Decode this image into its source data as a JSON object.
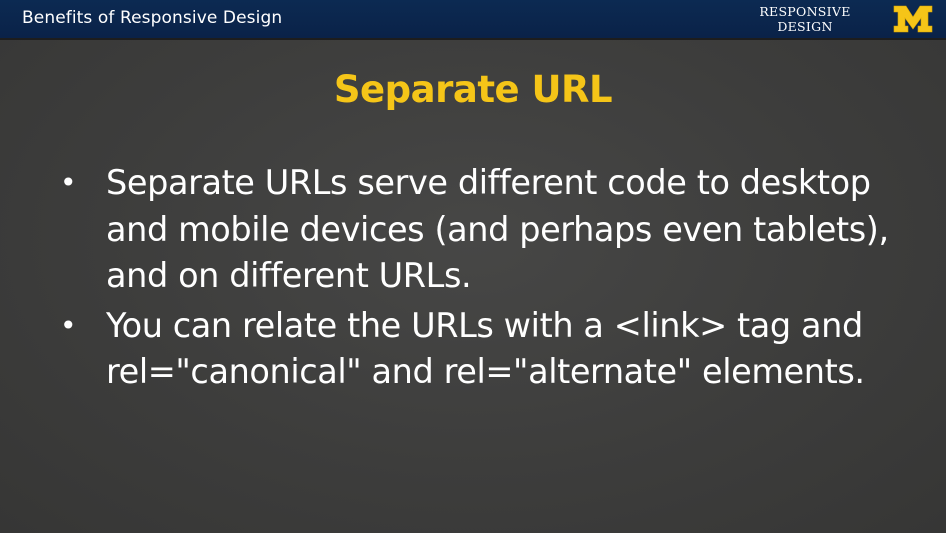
{
  "header": {
    "title": "Benefits of Responsive Design",
    "wordmark_line1": "RESPONSIVE",
    "wordmark_line2": "DESIGN",
    "logo_letter": "M",
    "logo_color": "#f5c518",
    "background_color": "#0c2a52"
  },
  "slide": {
    "title": "Separate URL",
    "title_color": "#f5c518",
    "bullets": [
      {
        "marker": "•",
        "text": "Separate URLs serve different code to desktop and mobile devices (and perhaps even tablets), and on different URLs."
      },
      {
        "marker": "•",
        "text": "You can relate the URLs with a <link> tag and rel=\"canonical\" and rel=\"alternate\" elements."
      }
    ]
  }
}
